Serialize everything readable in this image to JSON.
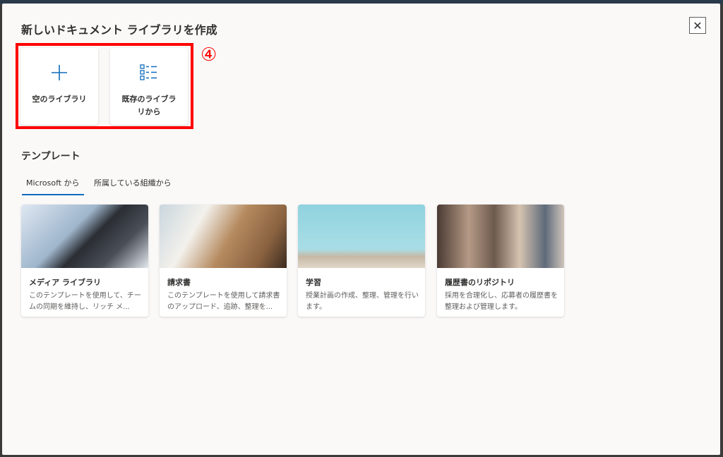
{
  "dialog": {
    "title": "新しいドキュメント ライブラリを作成",
    "close_icon": "close-icon"
  },
  "annotation": {
    "marker": "④",
    "color": "#ff0000"
  },
  "options": [
    {
      "label": "空のライブラリ",
      "icon": "plus-icon"
    },
    {
      "label": "既存のライブラリから",
      "icon": "list-icon"
    }
  ],
  "templates": {
    "heading": "テンプレート",
    "tabs": [
      {
        "label": "Microsoft から",
        "active": true
      },
      {
        "label": "所属している組織から",
        "active": false
      }
    ],
    "cards": [
      {
        "title": "メディア ライブラリ",
        "description": "このテンプレートを使用して、チームの同期を維持し、リッチ メ..."
      },
      {
        "title": "請求書",
        "description": "このテンプレートを使用して請求書のアップロード、追跡、整理を..."
      },
      {
        "title": "学習",
        "description": "授業計画の作成、整理、管理を行います。"
      },
      {
        "title": "履歴書のリポジトリ",
        "description": "採用を合理化し、応募者の履歴書を整理および管理します。"
      }
    ]
  },
  "accent": "#0f6cbd"
}
